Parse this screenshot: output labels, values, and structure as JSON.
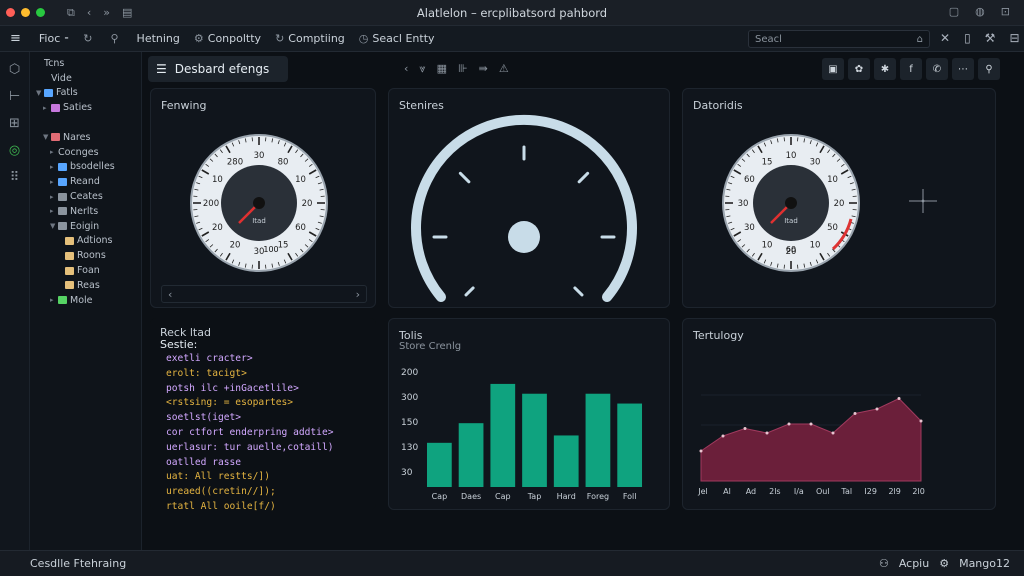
{
  "window": {
    "title": "Alatlelon – ercplibatsord pahbord"
  },
  "menubar": {
    "items": [
      {
        "icon": "file-icon",
        "label": "Fioc ⁃"
      },
      {
        "icon": "refresh-icon",
        "label": ""
      },
      {
        "icon": "search-icon",
        "label": ""
      },
      {
        "icon": "",
        "label": "Hetning"
      },
      {
        "icon": "gear-icon",
        "label": "Conpoltty"
      },
      {
        "icon": "refresh-icon",
        "label": "Comptiing"
      },
      {
        "icon": "clock-icon",
        "label": "Seacl Entty"
      }
    ],
    "search_placeholder": "Seacl"
  },
  "sidebar": {
    "items": [
      {
        "label": "Tcns",
        "indent": 0,
        "arrow": "",
        "color": ""
      },
      {
        "label": "Vide",
        "indent": 1,
        "arrow": "",
        "color": ""
      },
      {
        "label": "Fatls",
        "indent": 0,
        "arrow": "▼",
        "color": "#58a6ff"
      },
      {
        "label": "Saties",
        "indent": 1,
        "arrow": "▸",
        "color": "#c678dd"
      },
      {
        "label": "",
        "indent": 0,
        "arrow": "",
        "color": ""
      },
      {
        "label": "Nares",
        "indent": 1,
        "arrow": "▼",
        "color": "#e06c75"
      },
      {
        "label": "Cocnges",
        "indent": 2,
        "arrow": "▸",
        "color": ""
      },
      {
        "label": "bsodelles",
        "indent": 2,
        "arrow": "▸",
        "color": "#58a6ff"
      },
      {
        "label": "Reand",
        "indent": 2,
        "arrow": "▸",
        "color": "#58a6ff"
      },
      {
        "label": "Ceates",
        "indent": 2,
        "arrow": "▸",
        "color": "#8b949e"
      },
      {
        "label": "Nerlts",
        "indent": 2,
        "arrow": "▸",
        "color": "#8b949e"
      },
      {
        "label": "Eoigin",
        "indent": 2,
        "arrow": "▼",
        "color": "#8b949e"
      },
      {
        "label": "Adtions",
        "indent": 3,
        "arrow": "",
        "color": "#e5c07b"
      },
      {
        "label": "Roons",
        "indent": 3,
        "arrow": "",
        "color": "#e5c07b"
      },
      {
        "label": "Foan",
        "indent": 3,
        "arrow": "",
        "color": "#e5c07b"
      },
      {
        "label": "Reas",
        "indent": 3,
        "arrow": "",
        "color": "#e5c07b"
      },
      {
        "label": "Mole",
        "indent": 2,
        "arrow": "▸",
        "color": "#56d364"
      }
    ]
  },
  "main": {
    "tab": "Desbard efengs"
  },
  "panels": {
    "p1": {
      "title": "Fenwing",
      "ticks": [
        "30",
        "80",
        "10",
        "20",
        "60",
        "15",
        "30",
        "20",
        "20",
        "200",
        "10",
        "280"
      ],
      "label": "Itad",
      "value": "100"
    },
    "p2": {
      "title": "Stenires"
    },
    "p3": {
      "title": "Datoridis",
      "ticks": [
        "10",
        "30",
        "10",
        "20",
        "50",
        "10",
        "20",
        "10",
        "30",
        "30",
        "60",
        "15"
      ],
      "label": "Itad",
      "value": "60"
    },
    "p4": {
      "title": "Reck ltad",
      "subtitle": "Sestie:"
    },
    "p5": {
      "title": "Tolis",
      "subtitle": "Store Crenlg"
    },
    "p6": {
      "title": "Tertulogy"
    }
  },
  "code_lines": [
    {
      "t": "exetli cracter>",
      "c": "#d2a8ff"
    },
    {
      "t": "erolt: tacigt>",
      "c": "#e3b341"
    },
    {
      "t": "potsh ilc +inGacetlile>",
      "c": "#d2a8ff"
    },
    {
      "t": "<rstsing: = esopartes>",
      "c": "#e3b341"
    },
    {
      "t": "soetlst(iget>",
      "c": "#d2a8ff"
    },
    {
      "t": "cor ctfort enderpring addtie>",
      "c": "#d2a8ff"
    },
    {
      "t": "uerlasur: tur auelle,cotaill)",
      "c": "#d2a8ff"
    },
    {
      "t": "oatlled rasse",
      "c": "#d2a8ff"
    },
    {
      "t": "uat: All restts/])",
      "c": "#e3b341"
    },
    {
      "t": "ureaed((cretin//]);",
      "c": "#e3b341"
    },
    {
      "t": "rtatl All ooile[f/)",
      "c": "#e3b341"
    }
  ],
  "chart_data": [
    {
      "type": "bar",
      "title": "Tolis",
      "subtitle": "Store Crenlg",
      "categories": [
        "Cap",
        "Daes",
        "Cap",
        "Tap",
        "Hard",
        "Foreg",
        "Foll"
      ],
      "values": [
        90,
        130,
        210,
        190,
        105,
        190,
        170
      ],
      "yticks": [
        "200",
        "300",
        "150",
        "130",
        "30"
      ],
      "color": "#0fa37f"
    },
    {
      "type": "area",
      "title": "Tertulogy",
      "categories": [
        "Jel",
        "Al",
        "Ad",
        "2ls",
        "I/a",
        "Oul",
        "Tal",
        "I29",
        "2l9",
        "2l0"
      ],
      "values": [
        20,
        30,
        35,
        32,
        38,
        38,
        32,
        45,
        48,
        55,
        40
      ],
      "color": "#6b1f3a"
    }
  ],
  "statusbar": {
    "left": "Cesdlle Ftehraing",
    "r1": "Acpiu",
    "r2": "Mango12"
  }
}
